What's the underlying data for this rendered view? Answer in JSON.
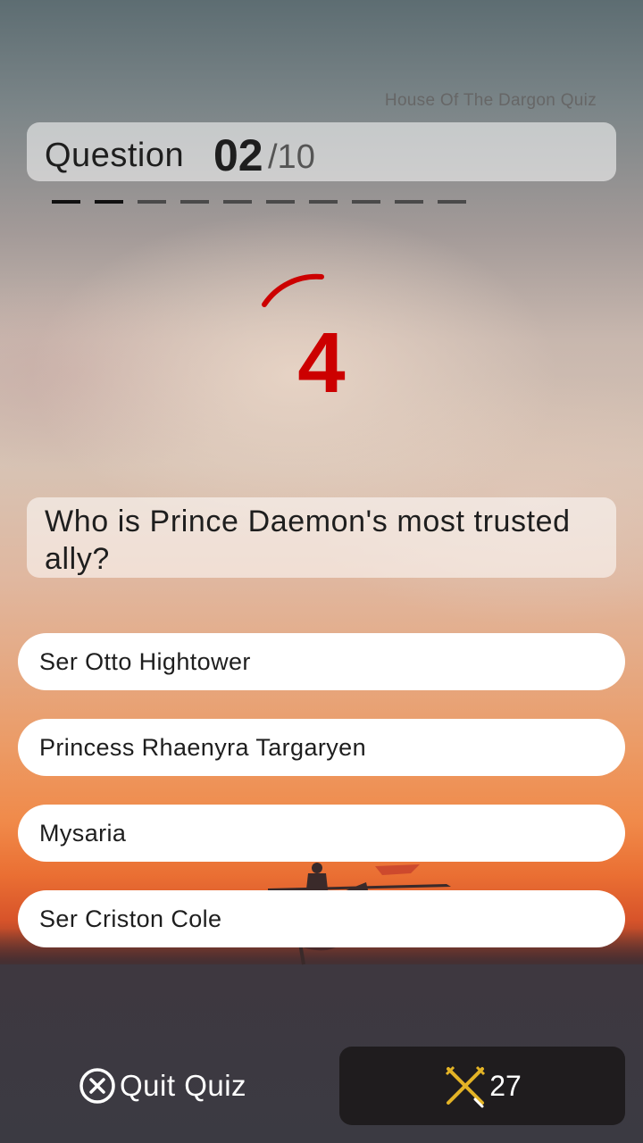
{
  "header": {
    "app_title": "House Of The Dargon Quiz",
    "question_label": "Question",
    "current_question": "02",
    "total_questions": "/10"
  },
  "progress": {
    "completed": 2,
    "total": 10
  },
  "timer": {
    "seconds_left": "4",
    "color": "#cc0000"
  },
  "question": {
    "text": "Who is Prince Daemon's most trusted ally?"
  },
  "options": [
    "Ser Otto Hightower",
    "Princess Rhaenyra Targaryen",
    "Mysaria",
    "Ser Criston Cole"
  ],
  "footer": {
    "quit_label": "Quit Quiz",
    "quit_icon": "close-circle-icon",
    "score_icon": "crossed-swords-icon",
    "score_value": "27"
  },
  "colors": {
    "accent": "#cc0000",
    "score_bg": "#1f1c1e",
    "swords": "#e3b326"
  }
}
